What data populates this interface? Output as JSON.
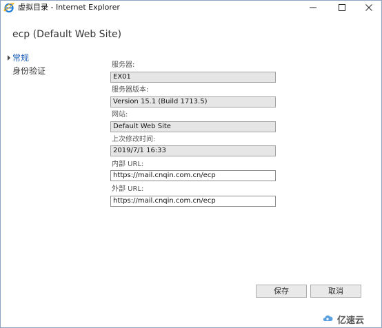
{
  "window": {
    "title": "虚拟目录 - Internet Explorer"
  },
  "page": {
    "title": "ecp (Default Web Site)"
  },
  "nav": {
    "items": [
      {
        "label": "常规",
        "selected": true
      },
      {
        "label": "身份验证",
        "selected": false
      }
    ]
  },
  "form": {
    "server": {
      "label": "服务器:",
      "value": "EX01"
    },
    "version": {
      "label": "服务器版本:",
      "value": "Version 15.1 (Build 1713.5)"
    },
    "site": {
      "label": "网站:",
      "value": "Default Web Site"
    },
    "modified": {
      "label": "上次修改时间:",
      "value": "2019/7/1 16:33"
    },
    "internal_url": {
      "label": "内部 URL:",
      "value": "https://mail.cnqin.com.cn/ecp"
    },
    "external_url": {
      "label": "外部 URL:",
      "value": "https://mail.cnqin.com.cn/ecp"
    }
  },
  "buttons": {
    "save": "保存",
    "cancel": "取消"
  },
  "watermark": {
    "text": "亿速云"
  },
  "colors": {
    "accent": "#1e5fb4",
    "readonly_bg": "#e6e6e6",
    "button_bg": "#e9e9e9"
  },
  "icons": [
    "ie-icon",
    "minimize-icon",
    "maximize-icon",
    "close-icon",
    "cloud-logo-icon"
  ]
}
